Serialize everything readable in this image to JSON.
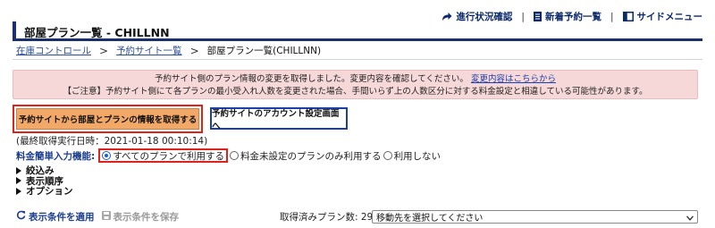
{
  "topnav": {
    "progress": "進行状況確認",
    "new_reservations": "新着予約一覧",
    "side_menu": "サイドメニュー",
    "separator": "|"
  },
  "page": {
    "title": "部屋プラン一覧 - CHILLNN"
  },
  "breadcrumb": {
    "items": [
      "在庫コントロール",
      "予約サイト一覧"
    ],
    "current": "部屋プラン一覧(CHILLNN)",
    "separator": ">"
  },
  "alert": {
    "line1": "予約サイト側のプラン情報の変更を取得しました。変更内容を確認してください。",
    "line1_link": "変更内容はこちらから",
    "line2": "【ご注意】予約サイト側にて各プランの最小受入れ人数を変更された場合、手間いらず上の人数区分に対する料金設定と相違している可能性があります。"
  },
  "buttons": {
    "fetch": "予約サイトから部屋とプランの情報を取得する",
    "account": "予約サイトのアカウント設定画面へ"
  },
  "last_fetch": "(最終取得実行日時：2021-01-18 00:10:14)",
  "rate_input": {
    "label": "料金簡単入力機能:",
    "options": [
      "すべてのプランで利用する",
      "料金未設定のプランのみ利用する",
      "利用しない"
    ],
    "selected_index": 0
  },
  "toggles": [
    "絞込み",
    "表示順序",
    "オプション"
  ],
  "bottom": {
    "apply": "表示条件を適用",
    "save": "表示条件を保存",
    "plan_count": "取得済みプラン数: 29",
    "select_value": "移動先を選択してください"
  },
  "colors": {
    "accent_navy": "#1b2f6e",
    "alert_bg": "#f6d8d8",
    "fetch_button": "#f2a968",
    "highlight_red": "#e0221b",
    "account_border": "#1c3ea8"
  }
}
